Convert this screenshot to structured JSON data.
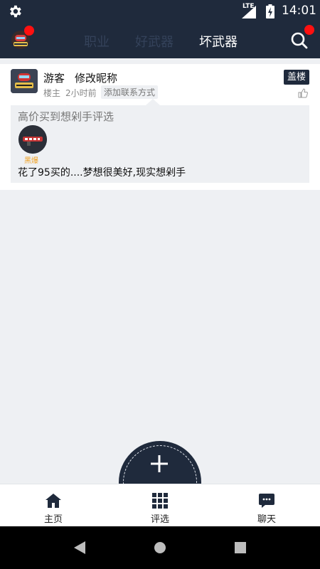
{
  "status_bar": {
    "network": "LTE",
    "time": "14:01"
  },
  "tabs": [
    {
      "label": "职业"
    },
    {
      "label": "好武器"
    },
    {
      "label": "坏武器"
    }
  ],
  "active_tab": "坏武器",
  "post": {
    "username": "游客",
    "edit_nickname": "修改昵称",
    "role": "楼主",
    "time_ago": "2小时前",
    "contact_label": "添加联系方式",
    "reply_label": "盖楼",
    "quote_title": "高价买到想剁手评选",
    "item_label": "黑爆",
    "comment": "花了95买的....梦想很美好,现实想剁手"
  },
  "bottom_nav": [
    {
      "label": "主页",
      "icon": "home-icon"
    },
    {
      "label": "评选",
      "icon": "grid-icon"
    },
    {
      "label": "聊天",
      "icon": "chat-icon"
    }
  ],
  "colors": {
    "primary": "#1f2a3c",
    "badge": "#ff1010",
    "item_label": "#f0a020"
  }
}
